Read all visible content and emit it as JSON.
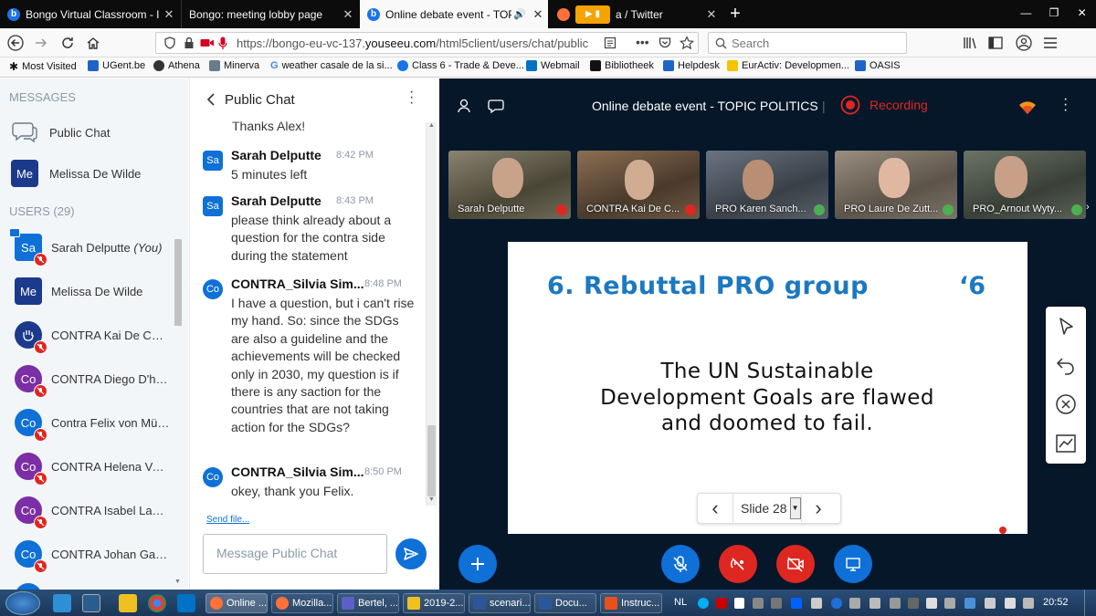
{
  "browser": {
    "tabs": [
      {
        "title": "Bongo Virtual Classroom - Inte",
        "active": false
      },
      {
        "title": "Bongo: meeting lobby page",
        "active": false
      },
      {
        "title": "Online debate event - TOPIC",
        "active": true
      },
      {
        "title": "a / Twitter",
        "active": false
      }
    ],
    "new_tab": "+",
    "url_prefix": "https://bongo-eu-vc-137.",
    "url_domain": "youseeu.com",
    "url_path": "/html5client/users/chat/public",
    "search_placeholder": "Search",
    "bookmarks": [
      "Most Visited",
      "UGent.be",
      "Athena",
      "Minerva",
      "weather casale de la si...",
      "Class 6 - Trade & Deve...",
      "Webmail",
      "Bibliotheek",
      "Helpdesk",
      "EurActiv: Developmen...",
      "OASIS"
    ],
    "window_controls": [
      "—",
      "❐",
      "✕"
    ]
  },
  "sidebar": {
    "messages_heading": "MESSAGES",
    "public_chat": "Public Chat",
    "private_chat": {
      "initials": "Me",
      "name": "Melissa De Wilde"
    },
    "users_heading": "USERS (29)",
    "users": [
      {
        "initials": "Sa",
        "name": "Sarah Delputte",
        "suffix": "(You)",
        "shape": "square",
        "color": "#0f70d7",
        "muted": true
      },
      {
        "initials": "Me",
        "name": "Melissa De Wilde",
        "suffix": "",
        "shape": "square",
        "color": "#1b3a8c",
        "muted": false
      },
      {
        "initials": "",
        "name": "CONTRA Kai De Cock",
        "suffix": "",
        "shape": "circle",
        "color": "#1b3a8c",
        "muted": true
      },
      {
        "initials": "Co",
        "name": "CONTRA Diego D'ho...",
        "suffix": "",
        "shape": "circle",
        "color": "#7b2ea6",
        "muted": true
      },
      {
        "initials": "Co",
        "name": "Contra Felix von Mül...",
        "suffix": "",
        "shape": "circle",
        "color": "#0f70d7",
        "muted": true
      },
      {
        "initials": "Co",
        "name": "CONTRA Helena Verl...",
        "suffix": "",
        "shape": "circle",
        "color": "#7b2ea6",
        "muted": true
      },
      {
        "initials": "Co",
        "name": "CONTRA Isabel Ladr...",
        "suffix": "",
        "shape": "circle",
        "color": "#7b2ea6",
        "muted": true
      },
      {
        "initials": "Co",
        "name": "CONTRA Johan Garfi...",
        "suffix": "",
        "shape": "circle",
        "color": "#0f70d7",
        "muted": true
      }
    ]
  },
  "chat": {
    "title": "Public Chat",
    "partial_message": "Thanks Alex!",
    "messages": [
      {
        "initials": "Sa",
        "name": "Sarah Delputte",
        "time": "8:42 PM",
        "text": "5 minutes left",
        "shape": "square"
      },
      {
        "initials": "Sa",
        "name": "Sarah Delputte",
        "time": "8:43 PM",
        "text": "please think already about a question for the contra side during the statement",
        "shape": "square"
      },
      {
        "initials": "Co",
        "name": "CONTRA_Silvia Sim...",
        "time": "8:48 PM",
        "text": "I have a question, but i can't rise my hand. So: since the SDGs are also a guideline and the achievements will be checked only in 2030, my question is if there is any saction for the countries that are not taking action for the SDGs?",
        "shape": "circle"
      },
      {
        "initials": "Co",
        "name": "CONTRA_Silvia Sim...",
        "time": "8:50 PM",
        "text": "okey, thank you Felix.",
        "shape": "circle"
      }
    ],
    "send_file": "Send file...",
    "input_placeholder": "Message Public Chat"
  },
  "main": {
    "meeting_title": "Online debate event - TOPIC POLITICS",
    "separator": "|",
    "recording_label": "Recording",
    "videos": [
      {
        "label": "Sarah Delputte",
        "bg": "#5e5a4a",
        "status": "muted"
      },
      {
        "label": "CONTRA Kai De C...",
        "bg": "#6a5a4a",
        "status": "muted"
      },
      {
        "label": "PRO Karen Sanch...",
        "bg": "#4a5058",
        "status": "talking"
      },
      {
        "label": "PRO Laure De Zutt...",
        "bg": "#70665c",
        "status": "talking"
      },
      {
        "label": "PRO_Arnout Wyty...",
        "bg": "#4e5650",
        "status": "talking"
      }
    ],
    "slide": {
      "title": "6. Rebuttal PRO group",
      "number": "‘6",
      "body": "The UN Sustainable Development Goals are flawed and doomed to fail."
    },
    "slide_nav": {
      "label": "Slide 28",
      "prev": "‹",
      "next": "›"
    }
  },
  "colors": {
    "accent": "#0f70d7",
    "danger": "#df2721",
    "main_bg": "#06172a",
    "slide_title": "#1c78c0"
  },
  "taskbar": {
    "buttons": [
      "Online ...",
      "Mozilla...",
      "Bertel, ...",
      "2019-2...",
      "scenari...",
      "Docu...",
      "Instruc..."
    ],
    "language": "NL",
    "clock": "20:52"
  }
}
